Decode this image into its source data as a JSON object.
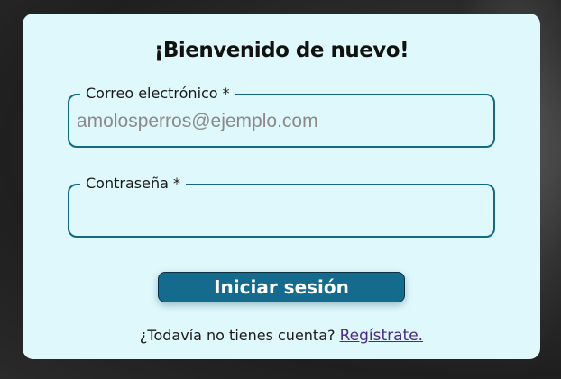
{
  "login": {
    "title": "¡Bienvenido de nuevo!",
    "email": {
      "label": "Correo electrónico *",
      "placeholder": "amolosperros@ejemplo.com",
      "value": ""
    },
    "password": {
      "label": "Contraseña *",
      "placeholder": "",
      "value": ""
    },
    "submit_label": "Iniciar sesión",
    "footer": {
      "question": "¿Todavía no tienes cuenta?",
      "link_label": "Regístrate."
    }
  },
  "colors": {
    "card_background": "#dff8fb",
    "accent": "#156b8e",
    "field_border": "#146a82",
    "link": "#4a2a8a"
  }
}
